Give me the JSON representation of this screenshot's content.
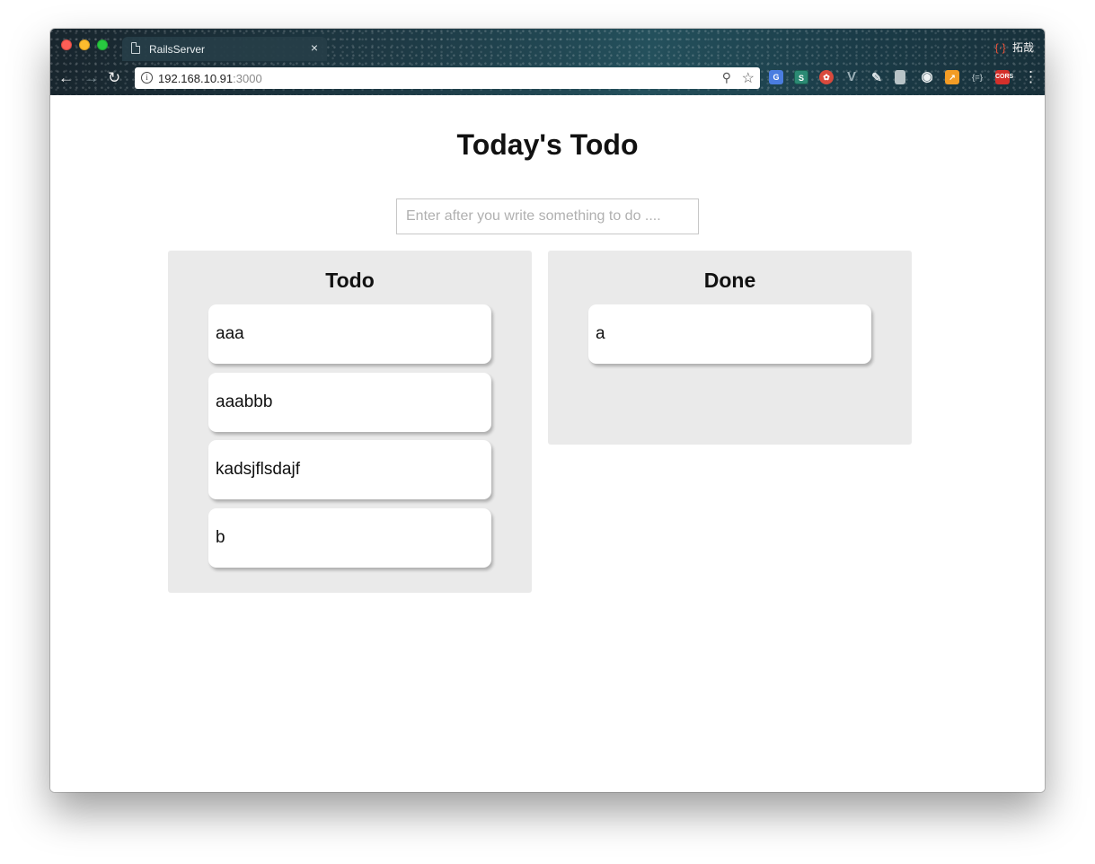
{
  "browser": {
    "tab_title": "RailsServer",
    "tab_close": "×",
    "profile_name": "拓哉",
    "profile_icon": "{·}",
    "url_host": "192.168.10.91",
    "url_port": ":3000",
    "nav": {
      "back": "←",
      "forward": "→",
      "reload": "↻"
    },
    "icons": {
      "info": "i",
      "zoom": "⚲",
      "star": "☆",
      "menu": "⋮"
    },
    "extensions": [
      {
        "name": "google-translate-icon",
        "glyph": "G"
      },
      {
        "name": "s-extension-icon",
        "glyph": "S"
      },
      {
        "name": "red-ladybug-icon",
        "glyph": "✿"
      },
      {
        "name": "vue-devtools-icon",
        "glyph": "V"
      },
      {
        "name": "pen-tool-icon",
        "glyph": "✎"
      },
      {
        "name": "gray-square-icon",
        "glyph": ""
      },
      {
        "name": "eye-icon",
        "glyph": "◉"
      },
      {
        "name": "analytics-chart-icon",
        "glyph": "↗"
      },
      {
        "name": "braces-icon",
        "glyph": "{=}"
      },
      {
        "name": "cors-icon",
        "glyph": "CORS"
      }
    ]
  },
  "page": {
    "title": "Today's Todo",
    "input_placeholder": "Enter after you write something to do ....",
    "input_value": ""
  },
  "columns": {
    "todo": {
      "title": "Todo",
      "items": [
        "aaa",
        "aaabbb",
        "kadsjflsdajf",
        "b"
      ]
    },
    "done": {
      "title": "Done",
      "items": [
        "a"
      ]
    }
  }
}
